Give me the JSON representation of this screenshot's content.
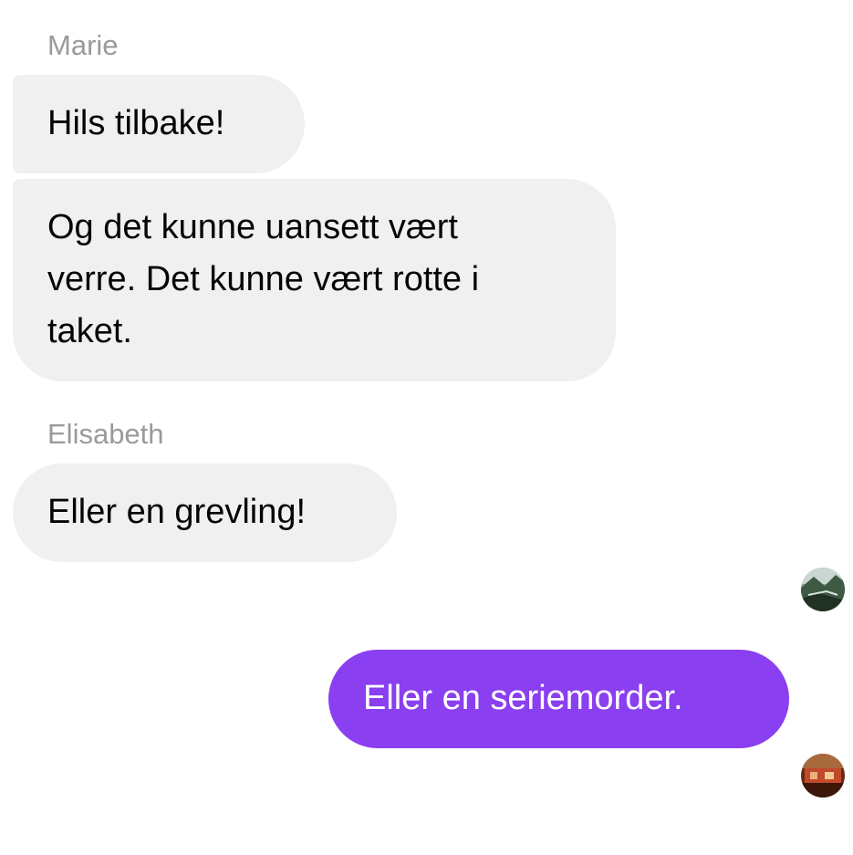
{
  "conversation": {
    "groups": [
      {
        "sender": "Marie",
        "messages": [
          {
            "text": "Hils tilbake!"
          },
          {
            "lines": [
              "Og det kunne uansett vært",
              "verre. Det kunne vært rotte i",
              "taket."
            ]
          }
        ]
      },
      {
        "sender": "Elisabeth",
        "messages": [
          {
            "text": "Eller en grevling!"
          }
        ]
      }
    ],
    "seen_avatars": [
      {
        "icon": "landscape-avatar-icon"
      }
    ],
    "outgoing": {
      "text": "Eller en seriemorder.",
      "bubble_color": "#8a3ff0"
    },
    "read_receipt_avatar": {
      "icon": "user-photo-avatar-icon"
    }
  },
  "colors": {
    "incoming_bubble": "#f0f0f0",
    "sender_name": "#9a9a9a",
    "outgoing_bubble": "#8a3ff0"
  }
}
